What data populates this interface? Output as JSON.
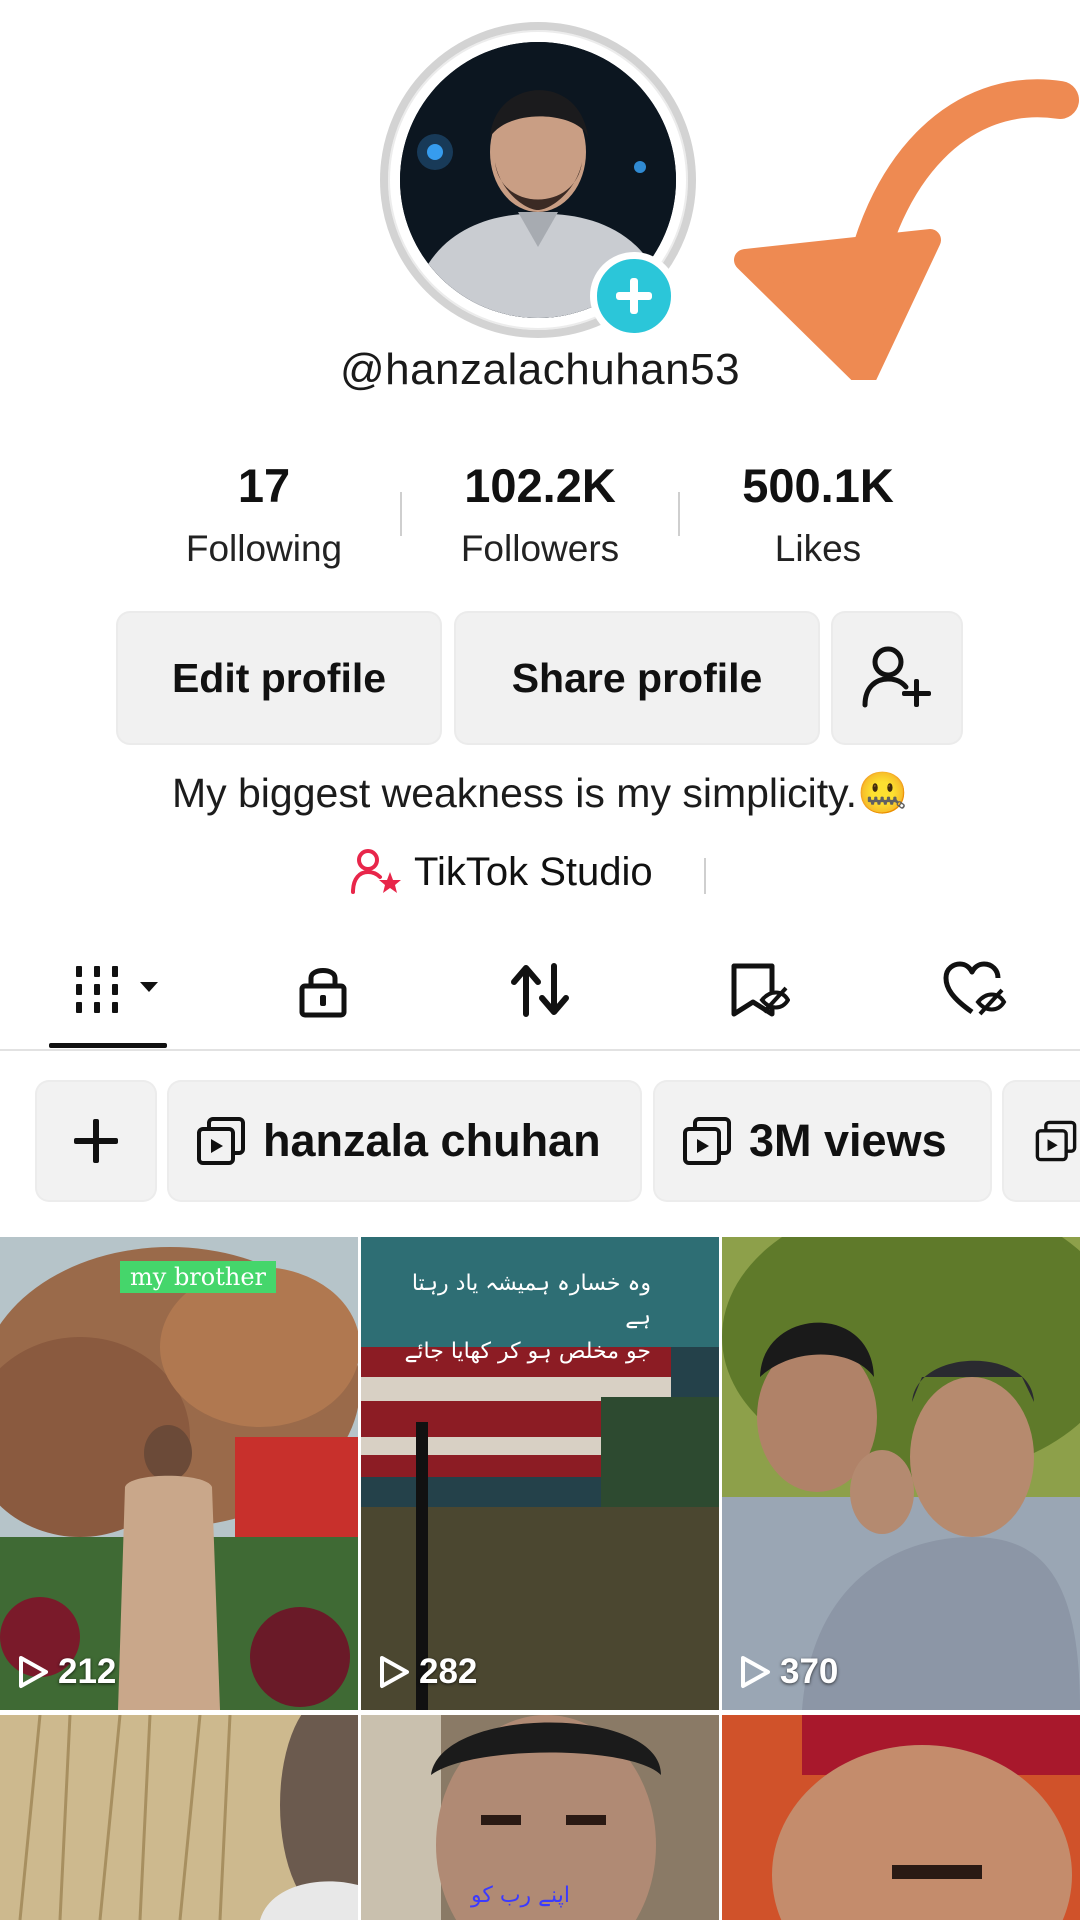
{
  "profile": {
    "username": "@hanzalachuhan53",
    "bio": "My biggest weakness is my simplicity.🤐",
    "studio_label": "TikTok Studio"
  },
  "stats": [
    {
      "value": "17",
      "label": "Following"
    },
    {
      "value": "102.2K",
      "label": "Followers"
    },
    {
      "value": "500.1K",
      "label": "Likes"
    }
  ],
  "actions": {
    "edit_label": "Edit profile",
    "share_label": "Share profile"
  },
  "tabs": [
    "videos-grid-icon",
    "lock-icon",
    "repost-icon",
    "saved-icon",
    "liked-icon"
  ],
  "collections": [
    {
      "label": "hanzala chuhan"
    },
    {
      "label": "3M views"
    }
  ],
  "videos": [
    {
      "views": "212",
      "caption": "my brother"
    },
    {
      "views": "282",
      "caption_lines": [
        "وہ خسارہ ہمیشہ یاد رہتا ہے",
        "جو مخلص ہو کر کھایا جائے"
      ]
    },
    {
      "views": "370"
    },
    {},
    {
      "caption": "اپنے رب کو"
    },
    {}
  ],
  "colors": {
    "accent_cyan": "#2bc6d9",
    "arrow_orange": "#ee8a52",
    "studio_red": "#e8264a"
  }
}
